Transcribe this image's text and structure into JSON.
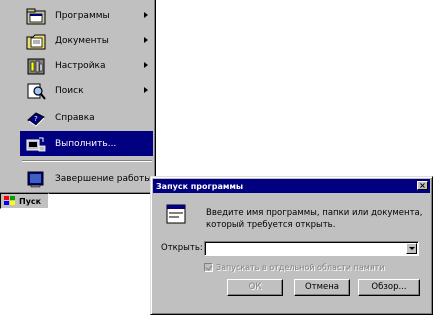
{
  "start_menu": {
    "items": [
      {
        "label": "Программы",
        "icon": "programs-folder-icon",
        "has_submenu": true
      },
      {
        "label": "Документы",
        "icon": "documents-folder-icon",
        "has_submenu": true
      },
      {
        "label": "Настройка",
        "icon": "settings-icon",
        "has_submenu": true
      },
      {
        "label": "Поиск",
        "icon": "find-icon",
        "has_submenu": true
      },
      {
        "label": "Справка",
        "icon": "help-book-icon",
        "has_submenu": false
      },
      {
        "label": "Выполнить...",
        "icon": "run-icon",
        "has_submenu": false,
        "selected": true
      }
    ],
    "shutdown_label": "Завершение работы..."
  },
  "taskbar": {
    "start_label": "Пуск"
  },
  "run_dialog": {
    "title": "Запуск программы",
    "close_label": "×",
    "prompt": "Введите имя программы, папки или документа, который требуется открыть.",
    "open_label": "Открыть:",
    "open_value": "",
    "checkbox_label": "Запускать в отдельной области памяти",
    "ok_label": "ОК",
    "cancel_label": "Отмена",
    "browse_label": "Обзор..."
  },
  "colors": {
    "selection": "#000080",
    "face": "#c0c0c0"
  }
}
